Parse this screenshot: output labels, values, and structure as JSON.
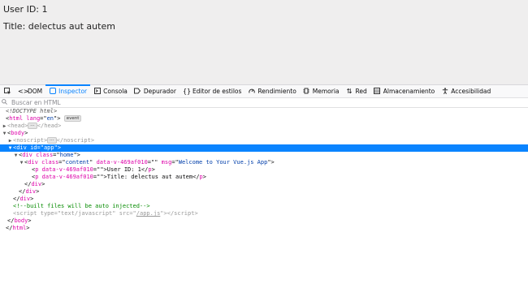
{
  "page": {
    "user_line": "User ID: 1",
    "title_line": "Title: delectus aut autem"
  },
  "toolbar": {
    "tabs": [
      {
        "label": "DOM",
        "icon": "dom-icon"
      },
      {
        "label": "Inspector",
        "icon": "inspector-icon"
      },
      {
        "label": "Consola",
        "icon": "console-icon"
      },
      {
        "label": "Depurador",
        "icon": "debugger-icon"
      },
      {
        "label": "Editor de estilos",
        "icon": "style-editor-icon"
      },
      {
        "label": "Rendimiento",
        "icon": "performance-icon"
      },
      {
        "label": "Memoria",
        "icon": "memory-icon"
      },
      {
        "label": "Red",
        "icon": "network-icon"
      },
      {
        "label": "Almacenamiento",
        "icon": "storage-icon"
      },
      {
        "label": "Accesibilidad",
        "icon": "accessibility-icon"
      }
    ],
    "active_tab": "Inspector",
    "accent_color": "#0a84ff"
  },
  "search": {
    "placeholder": "Buscar en HTML"
  },
  "tree": {
    "doctype": "<!DOCTYPE html>",
    "html_tag": "html",
    "html_lang_attr": "lang",
    "html_lang_val": "en",
    "event_badge": "event",
    "head_tag": "head",
    "ellipsis": "⋯",
    "body_tag": "body",
    "noscript_tag": "noscript",
    "div_tag": "div",
    "app_id_attr": "id",
    "app_id_val": "app",
    "class_attr": "class",
    "home_class": "home",
    "content_class": "content",
    "data_attr": "data-v-469af010",
    "empty_val": "",
    "msg_attr": "msg",
    "msg_val": "Welcome to Your Vue.js App",
    "p_tag": "p",
    "p1_text": "User ID: 1",
    "p2_text": "Title: delectus aut autem",
    "comment": "<!--built files will be auto injected-->",
    "script_tag": "script",
    "type_attr": "type",
    "type_val": "text/javascript",
    "src_attr": "src",
    "src_val": "/app.js"
  }
}
